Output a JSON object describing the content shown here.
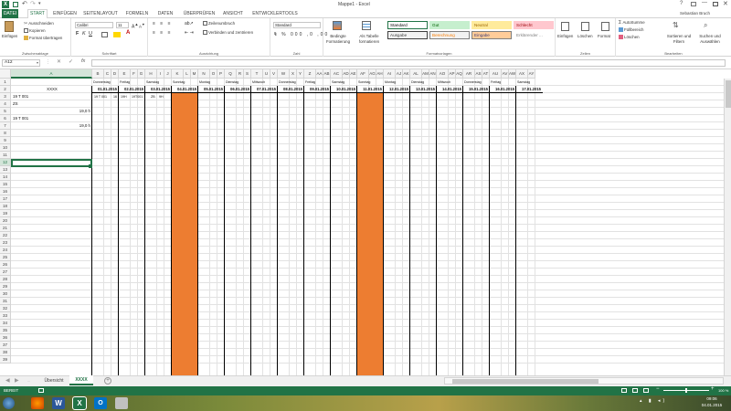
{
  "title_bar": {
    "title": "Mappe1 - Excel",
    "help": "?",
    "user": "Sebastian Bruch"
  },
  "tabs": [
    "DATEI",
    "START",
    "EINFÜGEN",
    "SEITENLAYOUT",
    "FORMELN",
    "DATEN",
    "ÜBERPRÜFEN",
    "ANSICHT",
    "ENTWICKLERTOOLS"
  ],
  "ribbon": {
    "clipboard": {
      "paste": "Einfügen",
      "cut": "Ausschneiden",
      "copy": "Kopieren",
      "format_painter": "Format übertragen",
      "label": "Zwischenablage"
    },
    "font": {
      "name": "Calibri",
      "size": "11",
      "label": "Schriftart"
    },
    "alignment": {
      "wrap": "Zeilenumbruch",
      "merge": "Verbinden und zentrieren",
      "label": "Ausrichtung"
    },
    "number": {
      "format": "Standard",
      "label": "Zahl"
    },
    "styles": {
      "conditional": "Bedingte Formatierung",
      "as_table": "Als Tabelle formatieren",
      "label": "Formatvorlagen",
      "cells": [
        {
          "text": "Standard",
          "bg": "#ffffff",
          "fg": "#000000",
          "border": "#217346"
        },
        {
          "text": "Gut",
          "bg": "#c6efce",
          "fg": "#006100",
          "border": "#c6efce"
        },
        {
          "text": "Neutral",
          "bg": "#ffeb9c",
          "fg": "#9c6500",
          "border": "#ffeb9c"
        },
        {
          "text": "Schlecht",
          "bg": "#ffc7ce",
          "fg": "#9c0006",
          "border": "#ffc7ce"
        },
        {
          "text": "Ausgabe",
          "bg": "#f2f2f2",
          "fg": "#3f3f3f",
          "border": "#3f3f3f"
        },
        {
          "text": "Berechnung",
          "bg": "#f2f2f2",
          "fg": "#fa7d00",
          "border": "#7f7f7f"
        },
        {
          "text": "Eingabe",
          "bg": "#ffcc99",
          "fg": "#3f3f76",
          "border": "#7f7f7f"
        },
        {
          "text": "Erklärender ...",
          "bg": "#ffffff",
          "fg": "#7f7f7f",
          "border": "#ffffff"
        }
      ]
    },
    "cells": {
      "insert": "Einfügen",
      "delete": "Löschen",
      "format": "Format",
      "label": "Zellen"
    },
    "editing": {
      "autosum": "AutoSumme",
      "fill": "Füllbereich",
      "clear": "Löschen",
      "sort": "Sortieren und Filtern",
      "find": "Suchen und Auswählen",
      "label": "Bearbeiten"
    }
  },
  "formula_bar": {
    "name_box": "A12",
    "fx": "fx",
    "formula": ""
  },
  "columns": [
    "A",
    "B",
    "C",
    "D",
    "E",
    "F",
    "G",
    "H",
    "I",
    "J",
    "K",
    "L",
    "M",
    "N",
    "O",
    "P",
    "Q",
    "R",
    "S",
    "T",
    "U",
    "V",
    "W",
    "X",
    "Y",
    "Z",
    "AA",
    "AB",
    "AC",
    "AD",
    "AE",
    "AF",
    "AG",
    "AH",
    "AI",
    "AJ",
    "AK",
    "AL",
    "AM",
    "AN",
    "AO",
    "AP",
    "AQ",
    "AR",
    "AS",
    "AT",
    "AU",
    "AV",
    "AW",
    "AX",
    "AY"
  ],
  "days": [
    {
      "weekday": "Donnerstag",
      "date": "01.01.2015"
    },
    {
      "weekday": "Freitag",
      "date": "02.01.2015"
    },
    {
      "weekday": "Samstag",
      "date": "03.01.2015"
    },
    {
      "weekday": "Sonntag",
      "date": "04.01.2015",
      "orange": true
    },
    {
      "weekday": "Montag",
      "date": "05.01.2015"
    },
    {
      "weekday": "Dienstag",
      "date": "06.01.2015"
    },
    {
      "weekday": "Mittwoch",
      "date": "07.01.2015"
    },
    {
      "weekday": "Donnerstag",
      "date": "08.01.2015"
    },
    {
      "weekday": "Freitag",
      "date": "09.01.2015"
    },
    {
      "weekday": "Samstag",
      "date": "10.01.2015"
    },
    {
      "weekday": "Sonntag",
      "date": "11.01.2015",
      "orange": true
    },
    {
      "weekday": "Montag",
      "date": "12.01.2015"
    },
    {
      "weekday": "Dienstag",
      "date": "13.01.2015"
    },
    {
      "weekday": "Mittwoch",
      "date": "14.01.2015"
    },
    {
      "weekday": "Donnerstag",
      "date": "15.01.2015"
    },
    {
      "weekday": "Freitag",
      "date": "16.01.2015"
    },
    {
      "weekday": "Samstag",
      "date": "17.01.2015"
    }
  ],
  "cells": {
    "A1": "XXXX",
    "A3": "19 T 001",
    "A4": "ZS",
    "A5": "19,0 h",
    "A6": "19 T 001",
    "A7": "19,0 h",
    "B3": "19 T 001",
    "C3": "16",
    "D3": "19H",
    "E3": "19T001",
    "F3": "ZB",
    "G3": "9H"
  },
  "rows": [
    "1",
    "2",
    "3",
    "4",
    "5",
    "6",
    "7",
    "8",
    "9",
    "10",
    "11",
    "12",
    "13",
    "14",
    "15",
    "16",
    "17",
    "18",
    "19",
    "20",
    "21",
    "22",
    "23",
    "24",
    "25",
    "26",
    "27",
    "28",
    "29",
    "30",
    "31",
    "32",
    "33",
    "34",
    "35",
    "36",
    "37",
    "38",
    "39"
  ],
  "sheets": {
    "tabs": [
      "Übersicht",
      "XXXX"
    ],
    "active": "XXXX",
    "add": "+"
  },
  "status": {
    "ready": "BEREIT",
    "zoom": "100 %"
  },
  "taskbar": {
    "time": "09:06",
    "date": "04.01.2015"
  }
}
